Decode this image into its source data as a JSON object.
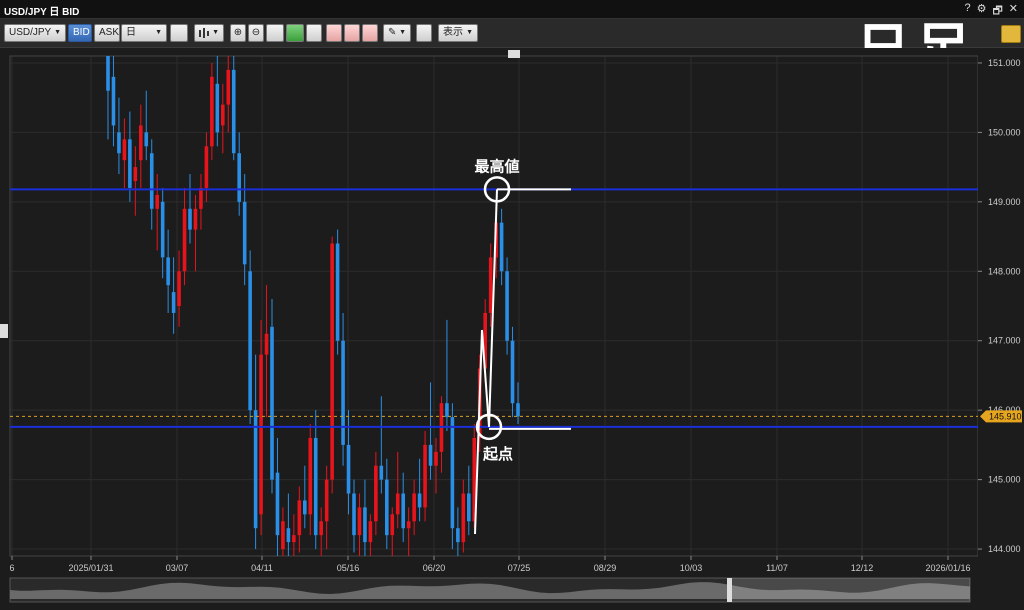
{
  "window": {
    "title": "USD/JPY 日 BID",
    "help": "?",
    "gear": "⚙",
    "restore": "🗗",
    "close": "✕"
  },
  "toolbar": {
    "symbol": "USD/JPY",
    "bid_label": "BID",
    "ask_label": "ASK",
    "period": "日",
    "display_label": "表示"
  },
  "overlay_title": "日足",
  "chart_data": {
    "type": "candlestick",
    "instrument": "USD/JPY",
    "price_type": "BID",
    "timeframe": "日",
    "ylim": [
      143.9,
      151.1
    ],
    "y_ticks": [
      151.0,
      150.0,
      149.0,
      148.0,
      147.0,
      146.0,
      145.0,
      144.0
    ],
    "x_tick_labels": [
      "6",
      "2025/01/31",
      "03/07",
      "04/11",
      "05/16",
      "06/20",
      "07/25",
      "08/29",
      "10/03",
      "11/07",
      "12/12",
      "2026/01/16"
    ],
    "current_price_label": "145.910",
    "current_price": 145.91,
    "levels": [
      {
        "name": "最高値",
        "value": 149.18
      },
      {
        "name": "起点",
        "value": 145.76
      }
    ],
    "candles": [
      [
        151.2,
        151.5,
        149.9,
        150.6
      ],
      [
        150.8,
        151.3,
        149.8,
        150.1
      ],
      [
        150.0,
        150.5,
        149.4,
        149.7
      ],
      [
        149.6,
        150.2,
        149.2,
        149.9
      ],
      [
        149.9,
        150.3,
        149.0,
        149.2
      ],
      [
        149.3,
        149.8,
        148.8,
        149.5
      ],
      [
        149.6,
        150.4,
        149.2,
        150.1
      ],
      [
        150.0,
        150.6,
        149.6,
        149.8
      ],
      [
        149.7,
        149.9,
        148.6,
        148.9
      ],
      [
        148.9,
        149.4,
        148.3,
        149.1
      ],
      [
        149.0,
        149.2,
        147.9,
        148.2
      ],
      [
        148.2,
        148.6,
        147.4,
        147.8
      ],
      [
        147.7,
        148.2,
        147.1,
        147.4
      ],
      [
        147.5,
        148.3,
        147.2,
        148.0
      ],
      [
        148.0,
        149.2,
        147.8,
        148.9
      ],
      [
        148.9,
        149.4,
        148.4,
        148.6
      ],
      [
        148.6,
        149.1,
        148.0,
        148.9
      ],
      [
        148.9,
        149.4,
        148.6,
        149.2
      ],
      [
        149.2,
        150.0,
        149.0,
        149.8
      ],
      [
        149.8,
        151.0,
        149.6,
        150.8
      ],
      [
        150.7,
        151.2,
        149.8,
        150.0
      ],
      [
        150.1,
        150.7,
        149.7,
        150.4
      ],
      [
        150.4,
        151.1,
        150.0,
        150.9
      ],
      [
        150.9,
        151.2,
        149.6,
        149.7
      ],
      [
        149.7,
        150.0,
        148.8,
        149.0
      ],
      [
        149.0,
        149.4,
        147.8,
        148.1
      ],
      [
        148.0,
        148.3,
        145.8,
        146.0
      ],
      [
        146.0,
        146.8,
        144.0,
        144.3
      ],
      [
        144.5,
        147.3,
        144.2,
        146.8
      ],
      [
        146.8,
        147.8,
        145.9,
        147.1
      ],
      [
        147.2,
        147.6,
        144.8,
        145.0
      ],
      [
        145.1,
        145.6,
        143.9,
        144.2
      ],
      [
        144.0,
        144.6,
        143.9,
        144.4
      ],
      [
        144.3,
        144.8,
        143.9,
        144.1
      ],
      [
        144.1,
        144.5,
        143.9,
        144.2
      ],
      [
        144.2,
        144.9,
        143.95,
        144.7
      ],
      [
        144.7,
        145.2,
        144.3,
        144.5
      ],
      [
        144.5,
        145.8,
        144.2,
        145.6
      ],
      [
        145.6,
        146.0,
        144.0,
        144.2
      ],
      [
        144.2,
        144.6,
        143.9,
        144.4
      ],
      [
        144.4,
        145.2,
        144.0,
        145.0
      ],
      [
        145.0,
        148.5,
        144.8,
        148.4
      ],
      [
        148.4,
        148.6,
        146.8,
        147.0
      ],
      [
        147.0,
        147.4,
        145.2,
        145.5
      ],
      [
        145.5,
        146.0,
        144.5,
        144.8
      ],
      [
        144.8,
        145.0,
        143.95,
        144.2
      ],
      [
        144.2,
        144.8,
        143.9,
        144.6
      ],
      [
        144.6,
        145.0,
        143.9,
        144.1
      ],
      [
        144.1,
        144.5,
        143.9,
        144.4
      ],
      [
        144.4,
        145.4,
        144.2,
        145.2
      ],
      [
        145.2,
        146.2,
        144.8,
        145.0
      ],
      [
        145.0,
        145.3,
        144.0,
        144.2
      ],
      [
        144.2,
        144.6,
        143.9,
        144.5
      ],
      [
        144.5,
        145.4,
        144.3,
        144.8
      ],
      [
        144.8,
        145.1,
        144.1,
        144.3
      ],
      [
        144.3,
        144.6,
        143.9,
        144.4
      ],
      [
        144.4,
        145.0,
        144.2,
        144.8
      ],
      [
        144.8,
        145.3,
        144.4,
        144.6
      ],
      [
        144.6,
        145.7,
        144.4,
        145.5
      ],
      [
        145.5,
        146.4,
        145.0,
        145.2
      ],
      [
        145.2,
        145.6,
        144.8,
        145.4
      ],
      [
        145.4,
        146.2,
        145.1,
        146.1
      ],
      [
        146.1,
        147.3,
        145.7,
        145.9
      ],
      [
        145.9,
        146.1,
        144.0,
        144.3
      ],
      [
        144.3,
        144.6,
        143.9,
        144.1
      ],
      [
        144.1,
        145.0,
        143.95,
        144.8
      ],
      [
        144.8,
        145.2,
        144.2,
        144.4
      ],
      [
        144.4,
        145.8,
        144.3,
        145.6
      ],
      [
        145.6,
        146.8,
        145.4,
        146.6
      ],
      [
        146.6,
        147.6,
        146.4,
        147.4
      ],
      [
        147.4,
        148.4,
        147.2,
        148.2
      ],
      [
        148.2,
        148.9,
        147.9,
        148.7
      ],
      [
        148.7,
        148.9,
        147.8,
        148.0
      ],
      [
        148.0,
        148.2,
        146.8,
        147.0
      ],
      [
        147.0,
        147.2,
        145.9,
        146.1
      ],
      [
        146.1,
        146.4,
        145.8,
        145.91
      ]
    ]
  }
}
